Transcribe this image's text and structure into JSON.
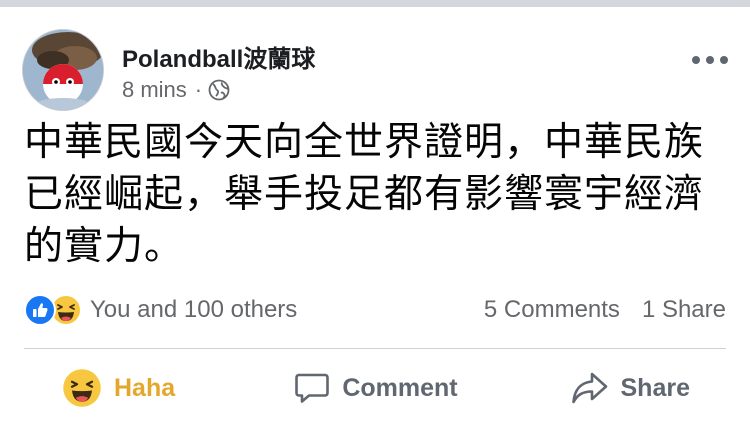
{
  "post": {
    "author": "Polandball波蘭球",
    "time": "8 mins",
    "separator": "·",
    "privacy_icon": "globe-icon",
    "more_icon": "more-options-icon",
    "text": "中華民國今天向全世界證明，中華民族已經崛起，舉手投足都有影響寰宇經濟的實力。"
  },
  "stats": {
    "reaction_icons": [
      "like-icon",
      "haha-icon"
    ],
    "reactions_text": "You and 100 others",
    "comments": "5 Comments",
    "shares": "1 Share"
  },
  "actions": {
    "haha_label": "Haha",
    "comment_label": "Comment",
    "share_label": "Share"
  },
  "colors": {
    "haha_accent": "#e3a82b",
    "like_blue": "#1877f2",
    "muted_text": "#65676b"
  }
}
